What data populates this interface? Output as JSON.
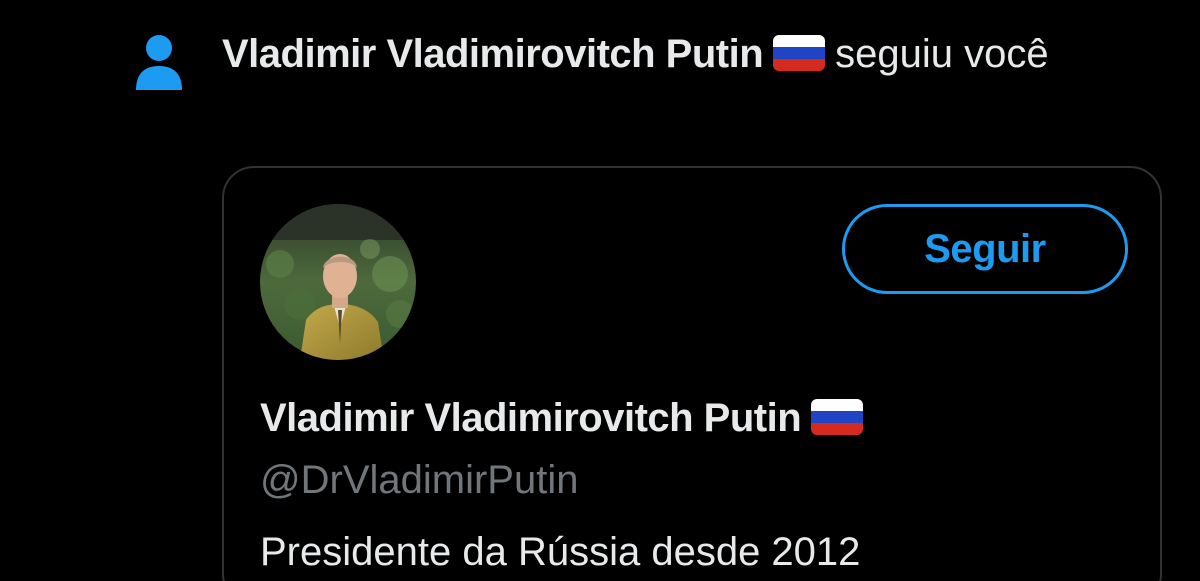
{
  "notification": {
    "icon": "person-icon",
    "actor_name": "Vladimir Vladimirovitch Putin",
    "actor_flag": "russia-flag-icon",
    "action_text": "seguiu você"
  },
  "card": {
    "avatar": "profile-photo",
    "follow_label": "Seguir",
    "name": "Vladimir Vladimirovitch Putin",
    "flag": "russia-flag-icon",
    "handle": "@DrVladimirPutin",
    "bio": "Presidente da Rússia desde 2012"
  },
  "colors": {
    "background": "#000000",
    "accent": "#1d9bf0",
    "primary_text": "#e7e9ea",
    "secondary_text": "#71767b",
    "border": "#2f3336"
  }
}
